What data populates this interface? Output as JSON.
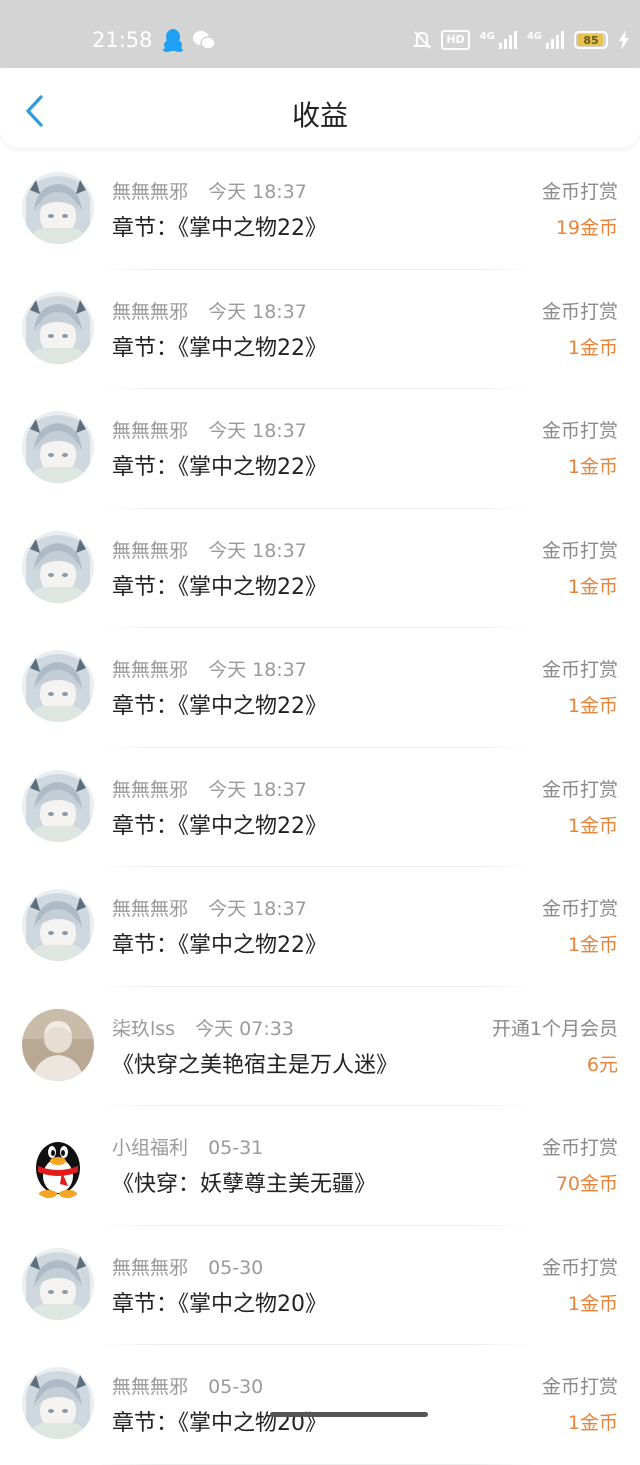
{
  "status_bar": {
    "time": "21:58",
    "network_1": "4G",
    "network_2": "4G",
    "hd_label": "HD",
    "battery": "85",
    "icons": [
      "qq-icon",
      "wechat-icon",
      "mute-icon",
      "hd-icon",
      "signal-icon",
      "signal-icon",
      "battery-icon",
      "charging-icon"
    ]
  },
  "header": {
    "title": "收益",
    "back_icon": "chevron-left-icon"
  },
  "colors": {
    "status_bar": "#d4d4d4",
    "back_icon": "#2d9cdb",
    "amount": "#e8843a",
    "secondary_text": "#9a9a9a",
    "primary_text": "#222222"
  },
  "income": [
    {
      "avatar": "anime",
      "name": "無無無邪",
      "time": "今天 18:37",
      "title": "章节：《掌中之物22》",
      "type": "金币打赏",
      "amount": "19金币"
    },
    {
      "avatar": "anime",
      "name": "無無無邪",
      "time": "今天 18:37",
      "title": "章节：《掌中之物22》",
      "type": "金币打赏",
      "amount": "1金币"
    },
    {
      "avatar": "anime",
      "name": "無無無邪",
      "time": "今天 18:37",
      "title": "章节：《掌中之物22》",
      "type": "金币打赏",
      "amount": "1金币"
    },
    {
      "avatar": "anime",
      "name": "無無無邪",
      "time": "今天 18:37",
      "title": "章节：《掌中之物22》",
      "type": "金币打赏",
      "amount": "1金币"
    },
    {
      "avatar": "anime",
      "name": "無無無邪",
      "time": "今天 18:37",
      "title": "章节：《掌中之物22》",
      "type": "金币打赏",
      "amount": "1金币"
    },
    {
      "avatar": "anime",
      "name": "無無無邪",
      "time": "今天 18:37",
      "title": "章节：《掌中之物22》",
      "type": "金币打赏",
      "amount": "1金币"
    },
    {
      "avatar": "anime",
      "name": "無無無邪",
      "time": "今天 18:37",
      "title": "章节：《掌中之物22》",
      "type": "金币打赏",
      "amount": "1金币"
    },
    {
      "avatar": "photo",
      "name": "柒玖lss",
      "time": "今天 07:33",
      "title": "《快穿之美艳宿主是万人迷》",
      "type": "开通1个月会员",
      "amount": "6元"
    },
    {
      "avatar": "penguin",
      "name": "小组福利",
      "time": "05-31",
      "title": "《快穿：妖孽尊主美无疆》",
      "type": "金币打赏",
      "amount": "70金币"
    },
    {
      "avatar": "anime",
      "name": "無無無邪",
      "time": "05-30",
      "title": "章节：《掌中之物20》",
      "type": "金币打赏",
      "amount": "1金币"
    },
    {
      "avatar": "anime",
      "name": "無無無邪",
      "time": "05-30",
      "title": "章节：《掌中之物20》",
      "type": "金币打赏",
      "amount": "1金币"
    }
  ]
}
